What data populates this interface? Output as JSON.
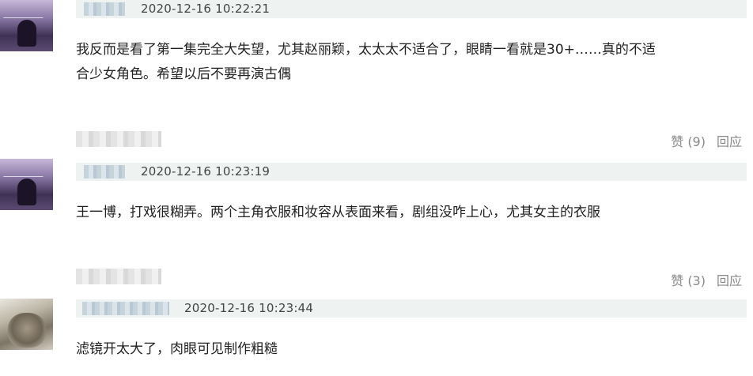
{
  "comments": [
    {
      "time": "2020-12-16 10:22:21",
      "text_line1": "我反而是看了第一集完全大失望，尤其赵丽颖，太太太不适合了，眼睛一看就是30+……真的不适",
      "text_line2": "合少女角色。希望以后不要再演古偶",
      "like_label": "赞",
      "like_count": "(9)",
      "reply_label": "回应"
    },
    {
      "time": "2020-12-16 10:23:19",
      "text_line1": "王一博，打戏很糊弄。两个主角衣服和妆容从表面来看，剧组没咋上心，尤其女主的衣服",
      "like_label": "赞",
      "like_count": "(3)",
      "reply_label": "回应"
    },
    {
      "time": "2020-12-16 10:23:44",
      "text_line1": "滤镜开太大了，肉眼可见制作粗糙"
    }
  ],
  "icons": {
    "avatar1": "avatar-purple-figure",
    "avatar2": "avatar-purple-figure",
    "avatar3": "avatar-cat"
  },
  "colors": {
    "meta_bg": "#eef3f1",
    "text": "#222222",
    "muted": "#888888"
  }
}
